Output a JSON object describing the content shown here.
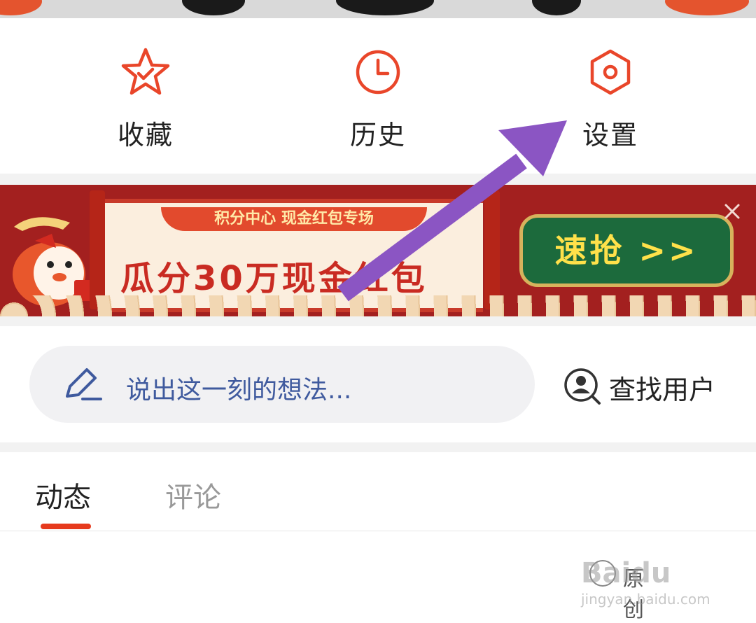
{
  "quick_actions": {
    "favorites_label": "收藏",
    "history_label": "历史",
    "settings_label": "设置"
  },
  "banner": {
    "subtitle": "积分中心 现金红包专场",
    "headline": "瓜分30万现金红包",
    "cta_label": "速抢 >>"
  },
  "post": {
    "placeholder": "说出这一刻的想法...",
    "find_user_label": "查找用户"
  },
  "tabs": {
    "active_label": "动态",
    "inactive_label": "评论"
  },
  "watermark": {
    "logo": "Baidu",
    "url": "jingyan.baidu.com",
    "original_label": "原创"
  },
  "colors": {
    "accent": "#e63a1d",
    "arrow": "#8b55c3",
    "placeholder_text": "#3f5a9e"
  }
}
